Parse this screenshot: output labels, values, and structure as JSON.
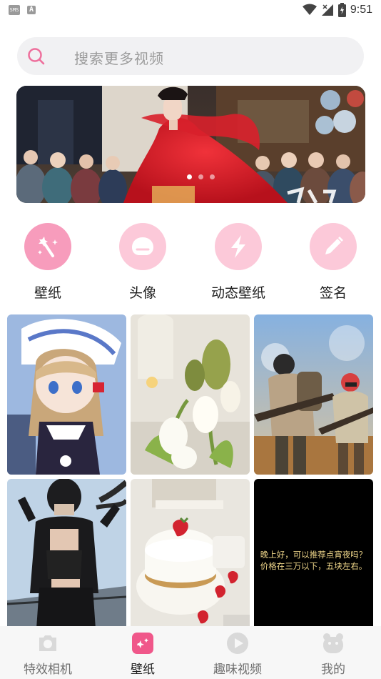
{
  "status_bar": {
    "left_icons": [
      "sms-notification-icon",
      "a-notification-icon"
    ],
    "sms_chip_text": "SMS",
    "a_chip_text": "A",
    "time": "9:51",
    "right_icons": [
      "wifi-icon",
      "cell-signal-icon",
      "battery-icon"
    ]
  },
  "search": {
    "icon": "search-icon",
    "placeholder": "搜索更多视频"
  },
  "banner": {
    "dot_count": 3,
    "active_dot": 0
  },
  "categories": [
    {
      "label": "壁纸",
      "icon": "magic-wand-icon"
    },
    {
      "label": "头像",
      "icon": "avatar-bubble-icon"
    },
    {
      "label": "动态壁纸",
      "icon": "lightning-icon"
    },
    {
      "label": "签名",
      "icon": "pencil-icon"
    }
  ],
  "grid": {
    "tiles": [
      {
        "subject": "anime girl"
      },
      {
        "subject": "tulips and cactus"
      },
      {
        "subject": "game soldiers"
      },
      {
        "subject": "leather outfit"
      },
      {
        "subject": "strawberry cake"
      },
      {
        "subject": "text wallpaper",
        "caption": "晚上好，可以推荐点宵夜吗？价格在三万以下，五块左右。"
      }
    ]
  },
  "bottom_nav": {
    "items": [
      {
        "label": "特效相机",
        "icon": "camera-icon",
        "active": false
      },
      {
        "label": "壁纸",
        "icon": "wallpaper-icon",
        "active": true
      },
      {
        "label": "趣味视频",
        "icon": "play-icon",
        "active": false
      },
      {
        "label": "我的",
        "icon": "profile-icon",
        "active": false
      }
    ]
  },
  "colors": {
    "accent_pink": "#f79cbc",
    "light_pink": "#fcc9d9",
    "caption_gold": "#f1d88b"
  }
}
